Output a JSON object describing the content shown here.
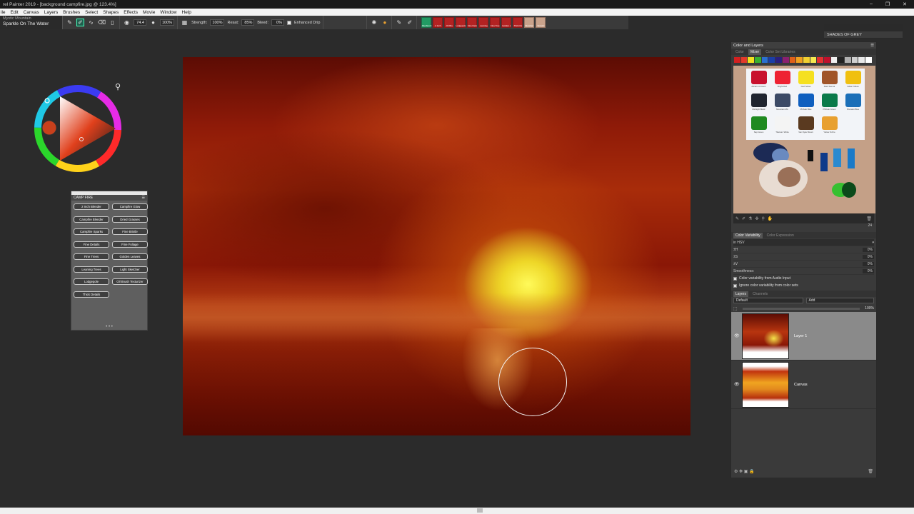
{
  "window": {
    "title": "rel Painter 2019 - [background campfire.jpg @ 123.4%]",
    "controls": [
      "–",
      "❐",
      "✕"
    ]
  },
  "menu": [
    "ile",
    "Edit",
    "Canvas",
    "Layers",
    "Brushes",
    "Select",
    "Shapes",
    "Effects",
    "Movie",
    "Window",
    "Help"
  ],
  "propbar": {
    "brush_category": "Mystic Mountain",
    "brush_variant": "Sparkle On The Water",
    "size_value": "74.4",
    "opacity_value": "100%",
    "strength_label": "Strength:",
    "strength_value": "100%",
    "resat_label": "Resat:",
    "resat_value": "85%",
    "bleed_label": "Bleed:",
    "bleed_value": "0%",
    "enhanced_drip_label": "Enhanced Drip"
  },
  "quick_panel": [
    {
      "label": "Jitterbrush",
      "color": "#229a63"
    },
    {
      "label": "2 Inch",
      "color": "#b32222"
    },
    {
      "label": "Oil Bru",
      "color": "#b32222"
    },
    {
      "label": "Lodgepole",
      "color": "#b32222"
    },
    {
      "label": "Fine Deta",
      "color": "#b32222"
    },
    {
      "label": "Leaning",
      "color": "#b32222"
    },
    {
      "label": "Fine Tree",
      "color": "#b32222"
    },
    {
      "label": "Golden L",
      "color": "#b32222"
    },
    {
      "label": "Thick De",
      "color": "#b32222"
    },
    {
      "label": "Sketcher",
      "color": "#c9a28b"
    },
    {
      "label": "Texturiz",
      "color": "#c9a28b"
    }
  ],
  "shades_palette": {
    "title": "SHADES OF GREY"
  },
  "campfire_palette": {
    "title": "CAMP FIRE",
    "buttons": [
      "2 Inch Blender",
      "Campfire Glow",
      "Campfire Blender",
      "Dried Grasses",
      "Campfire Sparks",
      "Fine Bristle",
      "Fine Details",
      "Fine Foliage",
      "Fine Trees",
      "Golden Leaves",
      "Leaning Trees",
      "Light Sketcher",
      "Lodgepole",
      "Oil Brush Texturizer",
      "Thick Details"
    ]
  },
  "color_layers_panel": {
    "title": "Color and Layers",
    "color_tabs": [
      "Color",
      "Mixer",
      "Color Set Libraries"
    ],
    "swatches": [
      "#d32020",
      "#e23a2a",
      "#f0e020",
      "#38b030",
      "#2a6fd0",
      "#1a3ea8",
      "#2a1f80",
      "#8a2070",
      "#e06018",
      "#f0a020",
      "#f2d030",
      "#f6e850",
      "#e33030",
      "#c0102c",
      "#f0f0f0",
      "#222222",
      "#b0b0b0",
      "#d0d0d0",
      "#e8e8e8",
      "#ffffff"
    ],
    "paints": [
      {
        "name": "Alizarin Crimson",
        "color": "#c8102e"
      },
      {
        "name": "Bright Red",
        "color": "#ee2233"
      },
      {
        "name": "Cad Yellow",
        "color": "#f5e020"
      },
      {
        "name": "Dark Sienna",
        "color": "#a0552a"
      },
      {
        "name": "Indian Yellow",
        "color": "#f0c010"
      },
      {
        "name": "Midnight Black",
        "color": "#202530"
      },
      {
        "name": "Mountain Mix",
        "color": "#3c4a66"
      },
      {
        "name": "Phthalo Blue",
        "color": "#0f5fbf"
      },
      {
        "name": "Phthalo Green",
        "color": "#0a7a4a"
      },
      {
        "name": "Prussian Blue",
        "color": "#1b6fb8"
      },
      {
        "name": "Sap Green",
        "color": "#1f8a20"
      },
      {
        "name": "Titanium White",
        "color": "#f4f4f4"
      },
      {
        "name": "Van Dyke Brown",
        "color": "#5a3a20"
      },
      {
        "name": "Yellow Ochre",
        "color": "#e8a030"
      }
    ],
    "mixer_value": "24",
    "variability_tabs": [
      "Color Variability",
      "Color Expression"
    ],
    "variability_mode": "in HSV",
    "variability_rows": [
      {
        "label": "±H",
        "value": "0%"
      },
      {
        "label": "±S",
        "value": "0%"
      },
      {
        "label": "±V",
        "value": "0%"
      },
      {
        "label": "Smoothness:",
        "value": "0%"
      }
    ],
    "variability_checks": [
      "Color variability from Audio Input",
      "Ignore color variability from color sets"
    ],
    "layer_tabs": [
      "Layers",
      "Channels"
    ],
    "composite_method": "Default",
    "composite_depth": "Add",
    "layer_opacity": "100%",
    "layers": [
      {
        "name": "Layer 1"
      },
      {
        "name": "Canvas"
      }
    ]
  }
}
